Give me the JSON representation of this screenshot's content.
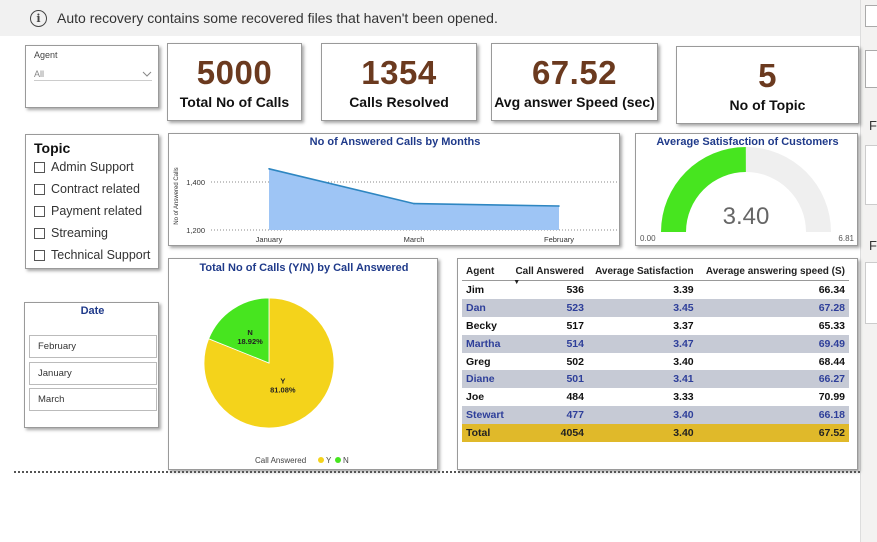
{
  "notification": {
    "text": "Auto recovery contains some recovered files that haven't been opened."
  },
  "agent_slicer": {
    "label": "Agent",
    "value": "All"
  },
  "kpis": [
    {
      "value": "5000",
      "label": "Total No of Calls"
    },
    {
      "value": "1354",
      "label": "Calls Resolved"
    },
    {
      "value": "67.52",
      "label": "Avg answer Speed (sec)"
    },
    {
      "value": "5",
      "label": "No of Topic"
    }
  ],
  "topic_slicer": {
    "title": "Topic",
    "items": [
      "Admin Support",
      "Contract related",
      "Payment related",
      "Streaming",
      "Technical Support"
    ]
  },
  "date_slicer": {
    "title": "Date",
    "items": [
      "February",
      "January",
      "March"
    ]
  },
  "chart_data": [
    {
      "type": "area",
      "title": "No of Answered Calls by Months",
      "ylabel": "No of Answered Calls",
      "xlabel": "",
      "categories": [
        "January",
        "March",
        "February"
      ],
      "values": [
        1455,
        1310,
        1300
      ],
      "ylim": [
        1200,
        1450
      ],
      "yticks": [
        1200,
        1400
      ],
      "ytick_labels": [
        "1,200",
        "1,400"
      ],
      "grid": true,
      "color": "#9ec5f5",
      "line_color": "#2e86c1"
    },
    {
      "type": "gauge",
      "title": "Average Satisfaction of Customers",
      "value": 3.4,
      "value_label": "3.40",
      "min": 0.0,
      "max": 6.81,
      "min_label": "0.00",
      "max_label": "6.81",
      "fill_color": "#47e51f",
      "track_color": "#efefef"
    },
    {
      "type": "pie",
      "title": "Total No of Calls (Y/N) by Call Answered",
      "legend_title": "Call Answered",
      "slices": [
        {
          "name": "Y",
          "value": 81.08,
          "label": "81.08%",
          "color": "#f4d31b"
        },
        {
          "name": "N",
          "value": 18.92,
          "label": "18.92%",
          "color": "#47e51f"
        }
      ]
    }
  ],
  "agent_table": {
    "columns": [
      "Agent",
      "Call Answered",
      "Average Satisfaction",
      "Average answering speed (S)"
    ],
    "rows": [
      [
        "Jim",
        "536",
        "3.39",
        "66.34"
      ],
      [
        "Dan",
        "523",
        "3.45",
        "67.28"
      ],
      [
        "Becky",
        "517",
        "3.37",
        "65.33"
      ],
      [
        "Martha",
        "514",
        "3.47",
        "69.49"
      ],
      [
        "Greg",
        "502",
        "3.40",
        "68.44"
      ],
      [
        "Diane",
        "501",
        "3.41",
        "66.27"
      ],
      [
        "Joe",
        "484",
        "3.33",
        "70.99"
      ],
      [
        "Stewart",
        "477",
        "3.40",
        "66.18"
      ]
    ],
    "total": [
      "Total",
      "4054",
      "3.40",
      "67.52"
    ]
  },
  "right_pane": {
    "labels": [
      "F",
      "F"
    ]
  }
}
